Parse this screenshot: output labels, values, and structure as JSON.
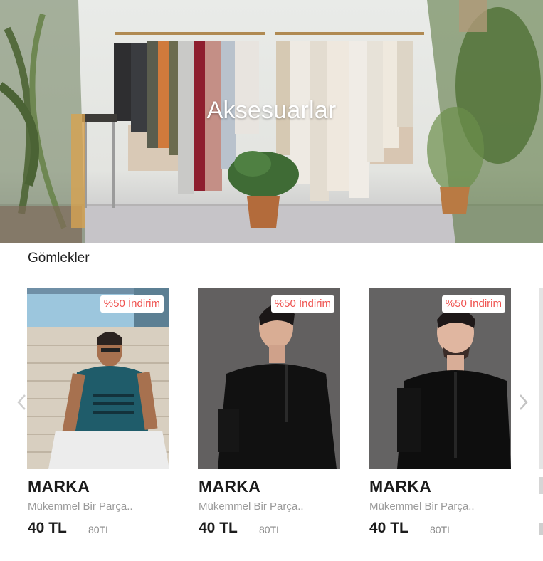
{
  "hero": {
    "title": "Aksesuarlar"
  },
  "section": {
    "title": "Gömlekler"
  },
  "products": [
    {
      "badge": "%50 İndirim",
      "brand": "MARKA",
      "description": "Mükemmel Bir Parça..",
      "price": "40 TL",
      "old_price": "80TL"
    },
    {
      "badge": "%50 İndirim",
      "brand": "MARKA",
      "description": "Mükemmel Bir Parça..",
      "price": "40 TL",
      "old_price": "80TL"
    },
    {
      "badge": "%50 İndirim",
      "brand": "MARKA",
      "description": "Mükemmel Bir Parça..",
      "price": "40 TL",
      "old_price": "80TL"
    }
  ],
  "carousel": {
    "prev_icon": "chevron-left-icon",
    "next_icon": "chevron-right-icon"
  },
  "colors": {
    "badge_text": "#ef5350",
    "text_dark": "#1c1c1c",
    "text_muted": "#9a9a9a"
  }
}
